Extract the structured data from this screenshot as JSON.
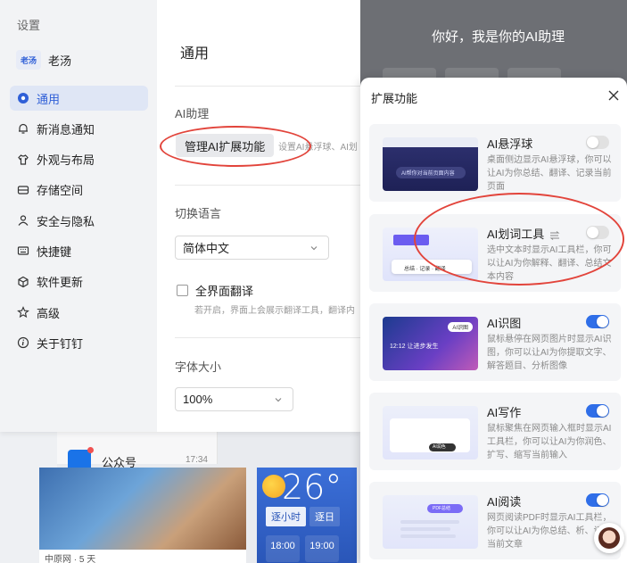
{
  "settings_window": {
    "title": "设置",
    "user": {
      "avatar_text": "老汤",
      "name": "老汤"
    },
    "nav": [
      {
        "label": "通用",
        "icon": "general-icon",
        "active": true
      },
      {
        "label": "新消息通知",
        "icon": "bell-icon"
      },
      {
        "label": "外观与布局",
        "icon": "shirt-icon"
      },
      {
        "label": "存储空间",
        "icon": "storage-icon"
      },
      {
        "label": "安全与隐私",
        "icon": "user-shield-icon"
      },
      {
        "label": "快捷键",
        "icon": "keyboard-icon"
      },
      {
        "label": "软件更新",
        "icon": "update-icon"
      },
      {
        "label": "高级",
        "icon": "star-icon"
      },
      {
        "label": "关于钉钉",
        "icon": "info-icon"
      }
    ],
    "content": {
      "page_title": "通用",
      "ai_section": {
        "label": "AI助理",
        "manage_button": "管理AI扩展功能",
        "description": "设置AI悬浮球、AI划"
      },
      "language_section": {
        "label": "切换语言",
        "selected": "简体中文"
      },
      "fullscreen_translate": {
        "label": "全界面翻译",
        "checked": false,
        "description": "若开启，界面上会展示翻译工具，翻译内"
      },
      "font_section": {
        "label": "字体大小",
        "selected": "100%"
      }
    }
  },
  "ai_assistant": {
    "greeting": "你好，我是你的AI助理"
  },
  "extension_panel": {
    "title": "扩展功能",
    "features": [
      {
        "name": "AI悬浮球",
        "description": "桌面侧边显示AI悬浮球，你可以让AI为你总结、翻译、记录当前页面",
        "enabled": false,
        "thumb_text": "AI帮你对当前页面内容"
      },
      {
        "name": "AI划词工具",
        "description": "选中文本时显示AI工具栏，你可以让AI为你解释、翻译、总结文本内容",
        "enabled": false,
        "thumb_text": "总结 · 记录 · 翻译"
      },
      {
        "name": "AI识图",
        "description": "鼠标悬停在网页图片时显示AI识图，你可以让AI为你提取文字、解答题目、分析图像",
        "enabled": true,
        "thumb_text": "AI识图",
        "thumb_sub": "12:12 让进步发生"
      },
      {
        "name": "AI写作",
        "description": "鼠标聚焦在网页输入框时显示AI工具栏，你可以让AI为你润色、扩写、缩写当前输入",
        "enabled": true,
        "thumb_text": "AI润色"
      },
      {
        "name": "AI阅读",
        "description": "网页阅读PDF时显示AI工具栏，你可以让AI为你总结、析、记录当前文章",
        "enabled": true,
        "thumb_text": "PDF总结"
      }
    ]
  },
  "background": {
    "chat_item": {
      "name": "公众号",
      "time": "17:34"
    },
    "news": {
      "source": "中原网 · 5 天"
    },
    "weather": {
      "temp": "26°",
      "tabs": [
        "逐小时",
        "逐日"
      ],
      "times": [
        "18:00",
        "19:00"
      ]
    }
  },
  "colors": {
    "accent": "#2f6ee8",
    "annotation": "#e2443b"
  }
}
